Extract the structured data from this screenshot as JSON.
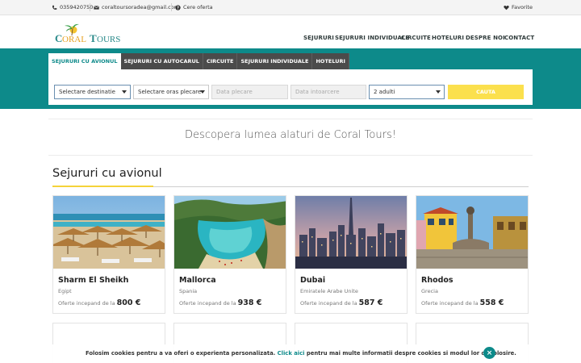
{
  "topbar": {
    "phone": "0359420750",
    "email": "coraltoursoradea@gmail.com",
    "request_offer": "Cere oferta",
    "favorites": "Favorite"
  },
  "header": {
    "logo_text": "CORAL TOURS",
    "nav": [
      "SEJURURI",
      "SEJURURI INDIVIDUALE",
      "CIRCUITE",
      "HOTELURI",
      "DESPRE NOI",
      "CONTACT"
    ]
  },
  "search": {
    "tabs": [
      "SEJURURI CU AVIONUL",
      "SEJURURI CU AUTOCARUL",
      "CIRCUITE",
      "SEJURURI INDIVIDUALE",
      "HOTELURI"
    ],
    "active_tab": 0,
    "destination": "Selectare destinatie",
    "departure_city": "Selectare oras plecare",
    "date_depart_placeholder": "Data plecare",
    "date_return_placeholder": "Data intoarcere",
    "guests": "2 adulti",
    "button": "CAUTA"
  },
  "tagline": "Descopera lumea alaturi de Coral Tours!",
  "section": {
    "title": "Sejururi cu avionul",
    "accent_color": "#f5d33a"
  },
  "cards": [
    {
      "title": "Sharm El Sheikh",
      "country": "Egipt",
      "offer_label": "Oferte incepand de la",
      "price": "800 €",
      "image": "beach-umbrellas-photo"
    },
    {
      "title": "Mallorca",
      "country": "Spania",
      "offer_label": "Oferte incepand de la",
      "price": "938 €",
      "image": "cove-beach-photo"
    },
    {
      "title": "Dubai",
      "country": "Emiratele Arabe Unite",
      "offer_label": "Oferte incepand de la",
      "price": "587 €",
      "image": "city-skyline-photo"
    },
    {
      "title": "Rhodos",
      "country": "Grecia",
      "offer_label": "Oferte incepand de la",
      "price": "558 €",
      "image": "town-square-photo"
    }
  ],
  "cookie": {
    "text_before": "Folosim cookies pentru a va oferi o experienta personalizata.",
    "link": "Click aici",
    "text_after": "pentru mai multe informatii despre cookies si modul lor de folosire.",
    "close": "×"
  },
  "colors": {
    "brand_teal": "#0d8a8a",
    "search_button": "#fbe04d",
    "tab_dark": "#4b4b4b"
  }
}
